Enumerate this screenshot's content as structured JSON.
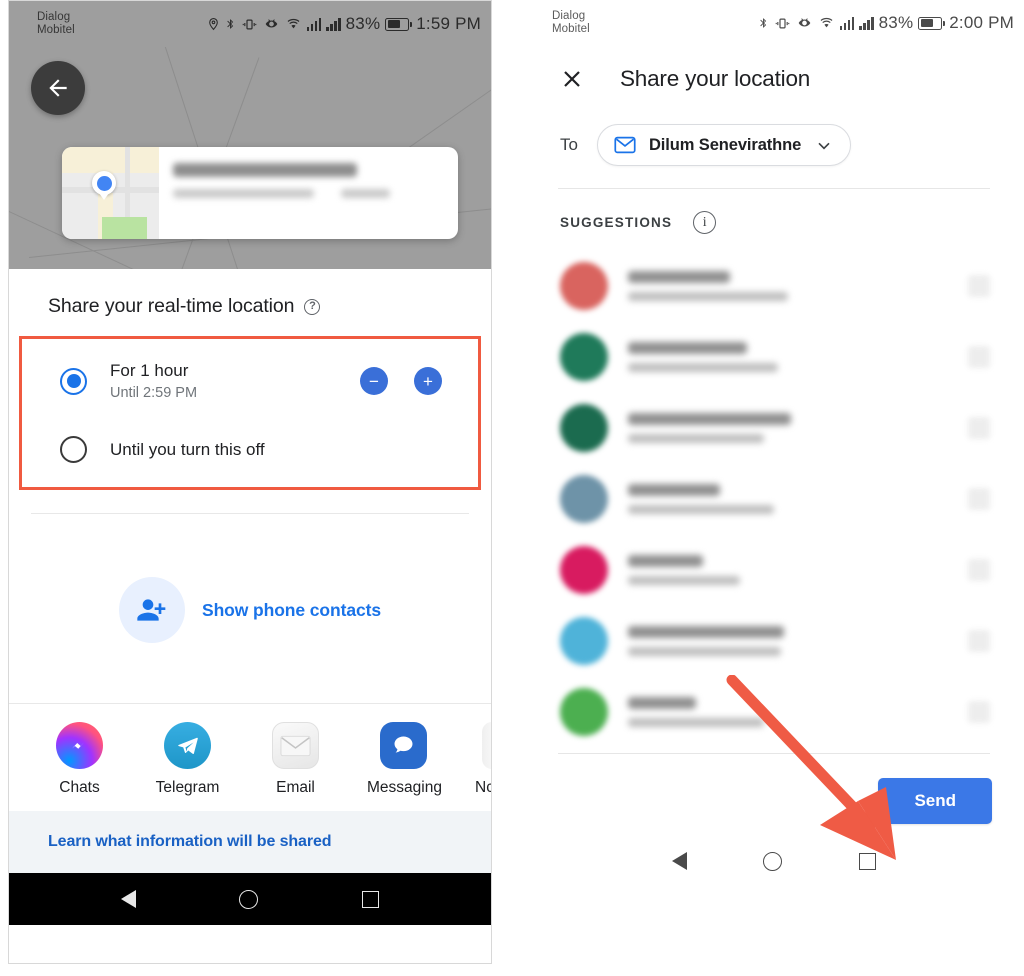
{
  "left_panel": {
    "status_bar": {
      "carrier_line1": "Dialog",
      "carrier_line2": "Mobitel",
      "battery_percent": "83%",
      "clock": "1:59 PM",
      "icons": [
        "location-icon",
        "bluetooth-icon",
        "vibrate-icon",
        "eye-icon",
        "wifi-icon",
        "signal-bars-icon",
        "signal-bars-icon",
        "battery-icon"
      ]
    },
    "map": {
      "back_button_icon": "arrow-back-icon",
      "card_pin_icon": "person-pin-icon",
      "card_title_blurred": true,
      "card_subtitle_blurred": true
    },
    "sheet": {
      "title": "Share your real-time location",
      "help_icon_glyph": "?",
      "duration_options": [
        {
          "label": "For 1 hour",
          "sublabel": "Until 2:59 PM",
          "selected": true
        },
        {
          "label": "Until you turn this off",
          "sublabel": "",
          "selected": false
        }
      ],
      "stepper_minus_label": "−",
      "stepper_plus_label": "+",
      "show_contacts_label": "Show phone contacts",
      "show_contacts_icon": "person-add-icon",
      "apps": [
        {
          "name": "Chats",
          "icon": "messenger-icon"
        },
        {
          "name": "Telegram",
          "icon": "telegram-icon"
        },
        {
          "name": "Email",
          "icon": "envelope-icon"
        },
        {
          "name": "Messaging",
          "icon": "chat-bubble-icon"
        },
        {
          "name": "Nc",
          "icon": "notes-icon"
        }
      ],
      "learn_more_label": "Learn what information will be shared"
    },
    "nav_bar": {
      "back": "nav-back-icon",
      "home": "nav-home-icon",
      "recents": "nav-recents-icon"
    }
  },
  "right_panel": {
    "status_bar": {
      "carrier_line1": "Dialog",
      "carrier_line2": "Mobitel",
      "battery_percent": "83%",
      "clock": "2:00 PM",
      "icons": [
        "bluetooth-icon",
        "vibrate-icon",
        "eye-icon",
        "wifi-icon",
        "signal-bars-icon",
        "signal-bars-icon",
        "battery-icon"
      ]
    },
    "header": {
      "title": "Share your location",
      "close_icon": "close-icon"
    },
    "to_field": {
      "label": "To",
      "recipient": "Dilum Senevirathne",
      "recipient_icon": "envelope-icon",
      "chevron_icon": "chevron-down-icon"
    },
    "suggestions": {
      "label": "SUGGESTIONS",
      "info_icon_glyph": "i",
      "rows": [
        {
          "avatar_color": "#d9645f",
          "name_blurred": true,
          "name_width": "30%",
          "sub_width": "47%"
        },
        {
          "avatar_color": "#1f7a5a",
          "name_blurred": true,
          "name_width": "35%",
          "sub_width": "44%"
        },
        {
          "avatar_color": "#1b6b4f",
          "name_blurred": true,
          "name_width": "48%",
          "sub_width": "40%"
        },
        {
          "avatar_color": "#6e93a8",
          "name_blurred": true,
          "name_width": "27%",
          "sub_width": "43%"
        },
        {
          "avatar_color": "#d81b60",
          "name_blurred": true,
          "name_width": "22%",
          "sub_width": "33%"
        },
        {
          "avatar_color": "#4fb3d9",
          "name_blurred": true,
          "name_width": "46%",
          "sub_width": "45%"
        },
        {
          "avatar_color": "#4caf50",
          "name_blurred": true,
          "name_width": "20%",
          "sub_width": "40%"
        }
      ]
    },
    "send_button_label": "Send",
    "nav_bar": {
      "back": "nav-back-icon",
      "home": "nav-home-icon",
      "recents": "nav-recents-icon"
    }
  },
  "annotations": {
    "highlight_box_color": "#f05a40",
    "arrow_color": "#ef5b45"
  },
  "colors": {
    "accent_blue": "#1a73e8",
    "send_blue": "#3b78e7",
    "stepper_blue": "#3a6fd8",
    "map_grey": "#9e9e9e",
    "banner_bg": "#f1f4f7"
  }
}
